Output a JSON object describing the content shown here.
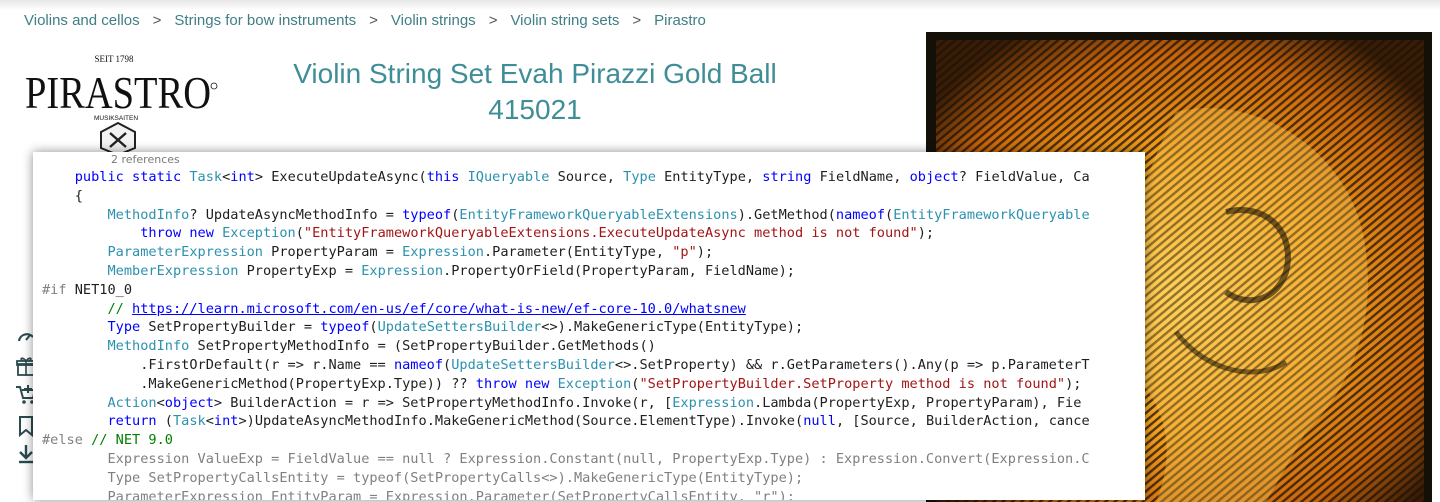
{
  "breadcrumb": {
    "items": [
      "Violins and cellos",
      "Strings for bow instruments",
      "Violin strings",
      "Violin string sets",
      "Pirastro"
    ],
    "separator": ">"
  },
  "logo": {
    "brand": "PIRASTRO",
    "since": "SEIT 1798",
    "tagline": "MUSIKSAITEN"
  },
  "product": {
    "title_line1": "Violin String Set Evah Pirazzi Gold Ball",
    "title_line2": "415021"
  },
  "side_icons": [
    "gauge-icon",
    "gift-icon",
    "cart-add-icon",
    "bookmark-icon",
    "download-icon"
  ],
  "code_window": {
    "references": "2 references",
    "lines": [
      [
        [
          "kw",
          "public static "
        ],
        [
          "ty",
          "Task"
        ],
        [
          "",
          "<"
        ],
        [
          "kw",
          "int"
        ],
        [
          "",
          "> ExecuteUpdateAsync("
        ],
        [
          "kw",
          "this "
        ],
        [
          "ty",
          "IQueryable"
        ],
        [
          "",
          " Source, "
        ],
        [
          "ty",
          "Type"
        ],
        [
          "",
          " EntityType, "
        ],
        [
          "kw",
          "string"
        ],
        [
          "",
          " FieldName, "
        ],
        [
          "kw",
          "object"
        ],
        [
          "",
          "? FieldValue, Ca"
        ]
      ],
      [
        [
          "",
          "{"
        ]
      ],
      [
        [
          "ty",
          "MethodInfo"
        ],
        [
          "",
          "? UpdateAsyncMethodInfo = "
        ],
        [
          "kw",
          "typeof"
        ],
        [
          "",
          "("
        ],
        [
          "ty",
          "EntityFrameworkQueryableExtensions"
        ],
        [
          "",
          ").GetMethod("
        ],
        [
          "kw",
          "nameof"
        ],
        [
          "",
          "("
        ],
        [
          "ty",
          "EntityFrameworkQueryable"
        ]
      ],
      [
        [
          "kw",
          "throw new "
        ],
        [
          "ty",
          "Exception"
        ],
        [
          "",
          "("
        ],
        [
          "st",
          "\"EntityFrameworkQueryableExtensions.ExecuteUpdateAsync method is not found\""
        ],
        [
          "",
          ");"
        ]
      ],
      [
        [
          "ty",
          "ParameterExpression"
        ],
        [
          "",
          " PropertyParam = "
        ],
        [
          "ty",
          "Expression"
        ],
        [
          "",
          ".Parameter(EntityType, "
        ],
        [
          "st",
          "\"p\""
        ],
        [
          "",
          ");"
        ]
      ],
      [
        [
          "ty",
          "MemberExpression"
        ],
        [
          "",
          " PropertyExp = "
        ],
        [
          "ty",
          "Expression"
        ],
        [
          "",
          ".PropertyOrField(PropertyParam, FieldName);"
        ]
      ],
      [
        [
          "pp",
          "#if"
        ],
        [
          "",
          " NET10_0"
        ]
      ],
      [
        [
          "cm",
          "// "
        ],
        [
          "lk",
          "https://learn.microsoft.com/en-us/ef/core/what-is-new/ef-core-10.0/whatsnew"
        ]
      ],
      [
        [
          "kw",
          "Type"
        ],
        [
          "",
          " SetPropertyBuilder = "
        ],
        [
          "kw",
          "typeof"
        ],
        [
          "",
          "("
        ],
        [
          "ty",
          "UpdateSettersBuilder"
        ],
        [
          "",
          "<>).MakeGenericType(EntityType);"
        ]
      ],
      [
        [
          "ty",
          "MethodInfo"
        ],
        [
          "",
          " SetPropertyMethodInfo = (SetPropertyBuilder.GetMethods()"
        ]
      ],
      [
        [
          "",
          ".FirstOrDefault(r => r.Name == "
        ],
        [
          "kw",
          "nameof"
        ],
        [
          "",
          "("
        ],
        [
          "ty",
          "UpdateSettersBuilder"
        ],
        [
          "",
          "<>.SetProperty) && r.GetParameters().Any(p => p.ParameterT"
        ]
      ],
      [
        [
          "",
          ".MakeGenericMethod(PropertyExp.Type)) ?? "
        ],
        [
          "kw",
          "throw new "
        ],
        [
          "ty",
          "Exception"
        ],
        [
          "",
          "("
        ],
        [
          "st",
          "\"SetPropertyBuilder.SetProperty method is not found\""
        ],
        [
          "",
          ");"
        ]
      ],
      [
        [
          "ty",
          "Action"
        ],
        [
          "",
          "<"
        ],
        [
          "kw",
          "object"
        ],
        [
          "",
          "> BuilderAction = r => SetPropertyMethodInfo.Invoke(r, ["
        ],
        [
          "ty",
          "Expression"
        ],
        [
          "",
          ".Lambda(PropertyExp, PropertyParam), Fie"
        ]
      ],
      [
        [
          "kw",
          "return "
        ],
        [
          "",
          "("
        ],
        [
          "ty",
          "Task"
        ],
        [
          "",
          "<"
        ],
        [
          "kw",
          "int"
        ],
        [
          "",
          ">)UpdateAsyncMethodInfo.MakeGenericMethod(Source.ElementType).Invoke("
        ],
        [
          "kw",
          "null"
        ],
        [
          "",
          ", [Source, BuilderAction, cance"
        ]
      ],
      [
        [
          "pp",
          "#else"
        ],
        [
          "",
          " "
        ],
        [
          "cm",
          "// NET 9.0"
        ]
      ],
      [
        [
          "pp",
          "Expression ValueExp = FieldValue == null ? Expression.Constant(null, PropertyExp.Type) : Expression.Convert(Expression.C"
        ]
      ],
      [
        [
          "pp",
          "Type SetPropertyCallsEntity = typeof(SetPropertyCalls<>).MakeGenericType(EntityType);"
        ]
      ],
      [
        [
          "pp",
          "ParameterExpression EntityParam = Expression.Parameter(SetPropertyCallsEntity, \"r\");"
        ]
      ]
    ],
    "indents": [
      4,
      4,
      8,
      12,
      8,
      8,
      0,
      8,
      8,
      8,
      12,
      12,
      8,
      8,
      0,
      8,
      8,
      8
    ]
  }
}
